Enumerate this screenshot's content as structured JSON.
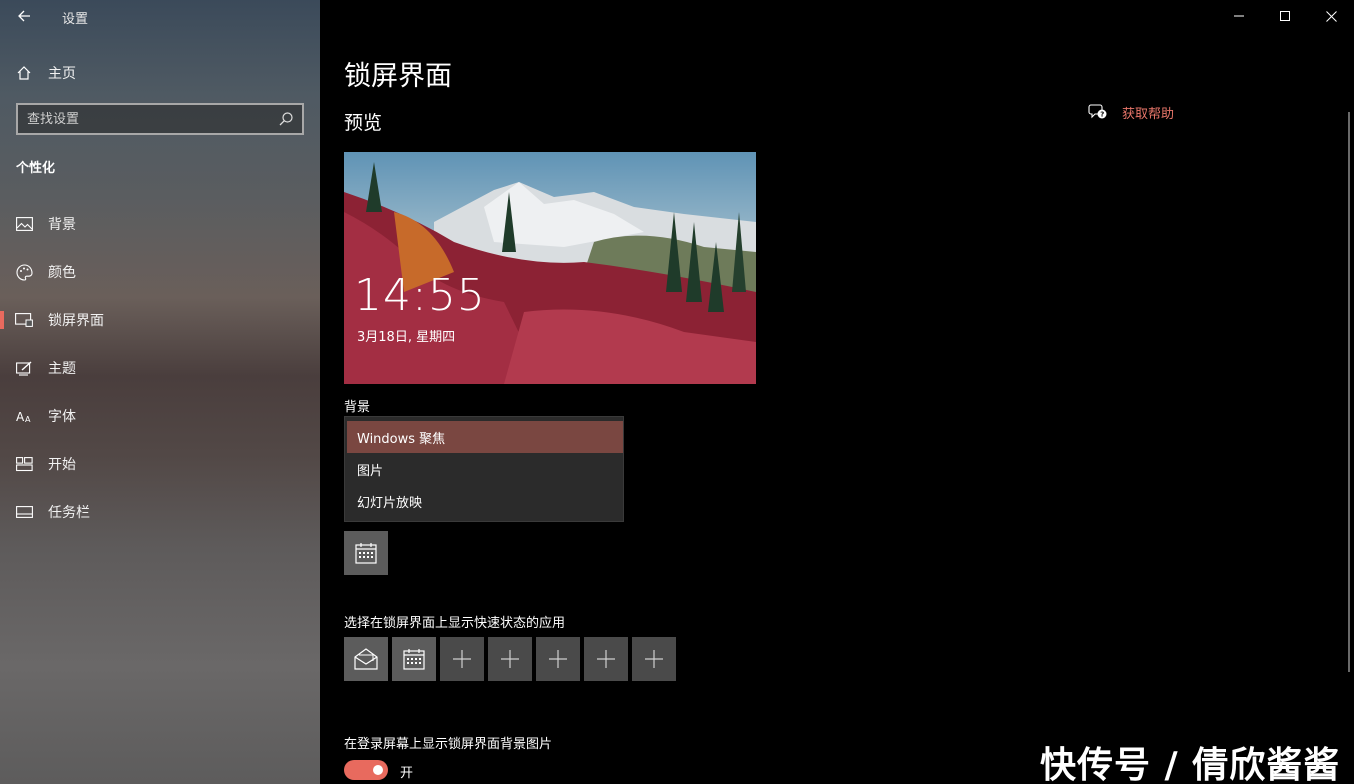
{
  "window": {
    "title": "设置",
    "controls": [
      "minimize-icon",
      "maximize-icon",
      "close-icon"
    ]
  },
  "sidebar": {
    "home_label": "主页",
    "search_placeholder": "查找设置",
    "section": "个性化",
    "items": [
      {
        "label": "背景",
        "icon": "image-icon"
      },
      {
        "label": "颜色",
        "icon": "palette-icon"
      },
      {
        "label": "锁屏界面",
        "icon": "lock-screen-icon",
        "active": true
      },
      {
        "label": "主题",
        "icon": "theme-icon"
      },
      {
        "label": "字体",
        "icon": "font-icon"
      },
      {
        "label": "开始",
        "icon": "start-icon"
      },
      {
        "label": "任务栏",
        "icon": "taskbar-icon"
      }
    ]
  },
  "main": {
    "title": "锁屏界面",
    "preview_heading": "预览",
    "help_label": "获取帮助",
    "preview": {
      "time": "14:55",
      "date": "3月18日, 星期四"
    },
    "background_label": "背景",
    "background_options": [
      "Windows 聚焦",
      "图片",
      "幻灯片放映"
    ],
    "background_selected": "Windows 聚焦",
    "detail_app_icon": "calendar-icon",
    "quick_status_label": "选择在锁屏界面上显示快速状态的应用",
    "quick_status_apps": [
      "mail-icon",
      "calendar-icon",
      "plus-icon",
      "plus-icon",
      "plus-icon",
      "plus-icon",
      "plus-icon"
    ],
    "login_bg_label": "在登录屏幕上显示锁屏界面背景图片",
    "login_bg_toggle": "开",
    "login_bg_on": true
  },
  "watermark": "快传号 / 倩欣酱酱",
  "colors": {
    "accent": "#e86a5e",
    "selected_item": "#7a4741",
    "link": "#e8766a"
  }
}
